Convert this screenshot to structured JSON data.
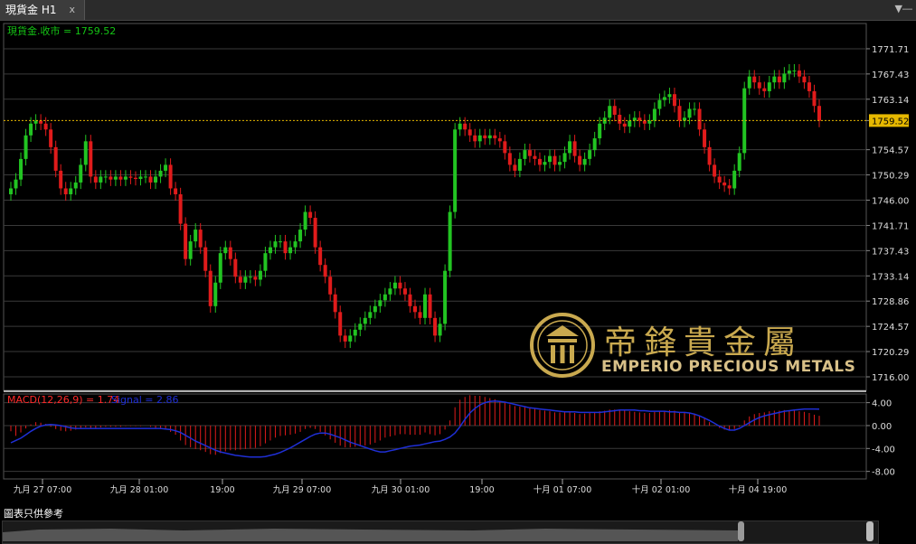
{
  "window": {
    "tab_title": "現貨金 H1",
    "close_glyph": "x",
    "menu_icon": "menu-down-icon"
  },
  "footer_label": "圖表只供參考",
  "logo": {
    "cn": "帝鋒貴金屬",
    "en": "EMPERIO PRECIOUS METALS"
  },
  "colors": {
    "up": "#22c422",
    "down": "#e01b1b",
    "grid": "#3a3a3a",
    "current_price": "#e6b800",
    "macd_line": "#1f2fd6",
    "macd_hist": "#e01b1b",
    "price_label": "#14c414",
    "macd_label": "#ff2a2a"
  },
  "chart_data": [
    {
      "type": "candlestick",
      "title": "現貨金.收市 = 1759.52",
      "current_price": 1759.52,
      "current_price_label": "1759.52",
      "ylim": [
        1713.7,
        1776.0
      ],
      "y_ticks": [
        "1771.71",
        "1767.43",
        "1763.14",
        "1759.52",
        "1754.57",
        "1750.29",
        "1746.00",
        "1741.71",
        "1737.43",
        "1733.14",
        "1728.86",
        "1724.57",
        "1720.29",
        "1716.00"
      ],
      "x_tick_labels": [
        "九月 27 07:00",
        "九月 28 01:00",
        "19:00",
        "九月 29 07:00",
        "九月 30 01:00",
        "19:00",
        "十月 01 07:00",
        "十月 02 01:00",
        "十月 04 19:00"
      ],
      "closes": [
        1748,
        1749.5,
        1753,
        1757,
        1759,
        1759.5,
        1759,
        1758,
        1755,
        1751,
        1748,
        1747,
        1748,
        1749,
        1752,
        1756,
        1750,
        1749,
        1750,
        1750,
        1749.5,
        1750,
        1749.5,
        1750,
        1749.8,
        1749.6,
        1750,
        1750,
        1749,
        1750,
        1751,
        1752,
        1748,
        1747,
        1742,
        1736,
        1739,
        1741,
        1738,
        1734,
        1728,
        1732,
        1737,
        1738,
        1736,
        1733,
        1732,
        1733,
        1733,
        1732.5,
        1734,
        1737,
        1738,
        1739,
        1739,
        1737,
        1738,
        1739,
        1741,
        1744,
        1743,
        1738,
        1735,
        1733,
        1730,
        1727,
        1723,
        1722,
        1723,
        1724,
        1725,
        1726,
        1727,
        1728,
        1729,
        1730,
        1731,
        1732,
        1731,
        1730,
        1728,
        1727,
        1726,
        1730,
        1726,
        1723,
        1725,
        1734,
        1744,
        1758,
        1759,
        1758,
        1757,
        1756,
        1757,
        1756.5,
        1757,
        1756.5,
        1756,
        1754,
        1752,
        1751,
        1753,
        1754.5,
        1753.5,
        1753,
        1752,
        1752.5,
        1753.5,
        1752,
        1752.5,
        1754,
        1756,
        1753.5,
        1752,
        1753,
        1754.5,
        1756.5,
        1759,
        1760,
        1762,
        1760.5,
        1759,
        1758.5,
        1759.5,
        1760,
        1759.5,
        1759,
        1759.5,
        1761.5,
        1763,
        1763.5,
        1764,
        1762,
        1759.5,
        1760,
        1761.5,
        1761.5,
        1758,
        1755,
        1752,
        1750,
        1749,
        1748.5,
        1748,
        1751,
        1754,
        1765,
        1767,
        1766,
        1765,
        1764.5,
        1766,
        1767,
        1766,
        1767.5,
        1768,
        1768,
        1767,
        1766,
        1764.5,
        1762,
        1759.5
      ]
    },
    {
      "type": "macd",
      "label": "MACD(12,26,9) = 1.74",
      "signal_label": "Signal = 2.86",
      "ylim": [
        -9.0,
        5.2
      ],
      "y_ticks": [
        "4.00",
        "0.00",
        "-4.00",
        "-8.00"
      ],
      "histogram": [
        -1,
        -1.8,
        -1.2,
        -0.5,
        0.2,
        0.6,
        0.5,
        0.3,
        -0.2,
        -0.6,
        -0.9,
        -1,
        -0.9,
        -0.7,
        -0.5,
        -0.3,
        -0.4,
        -0.4,
        -0.3,
        -0.2,
        -0.2,
        -0.2,
        -0.2,
        -0.1,
        -0.1,
        -0.1,
        -0.1,
        0,
        -0.2,
        -0.4,
        -0.6,
        -0.6,
        -1.1,
        -1.6,
        -2.6,
        -3.4,
        -3.8,
        -4.1,
        -4.3,
        -4.6,
        -5,
        -5.1,
        -4.8,
        -4.5,
        -4.3,
        -4.3,
        -4.2,
        -4.1,
        -4,
        -3.9,
        -3.6,
        -3.1,
        -2.6,
        -2.1,
        -1.8,
        -1.7,
        -1.6,
        -1.4,
        -1.1,
        -0.6,
        -0.4,
        -0.6,
        -1.1,
        -1.7,
        -2.4,
        -3,
        -3.5,
        -3.8,
        -3.8,
        -3.7,
        -3.6,
        -3.5,
        -3.3,
        -3,
        -2.6,
        -2.1,
        -1.9,
        -1.7,
        -1.5,
        -1.5,
        -1.6,
        -1.6,
        -1.6,
        -1.2,
        -1.5,
        -1.7,
        -1.5,
        -0.7,
        0.9,
        3.2,
        4.5,
        5,
        5.3,
        5.2,
        5.2,
        5,
        4.8,
        4.6,
        4.3,
        4,
        3.7,
        3.4,
        3.3,
        3.2,
        3,
        2.9,
        2.7,
        2.6,
        2.5,
        2.3,
        2.3,
        2.3,
        2.4,
        2.2,
        2,
        2.1,
        2.2,
        2.2,
        2.5,
        2.6,
        2.8,
        2.8,
        2.7,
        2.6,
        2.5,
        2.4,
        2.3,
        2.2,
        2.2,
        2.4,
        2.5,
        2.6,
        2.7,
        2.6,
        2.3,
        2.2,
        2.2,
        2.1,
        1.7,
        1.2,
        0.6,
        0.1,
        -0.4,
        -0.7,
        -0.8,
        -0.6,
        -0.2,
        0.9,
        1.6,
        2,
        2.2,
        2.3,
        2.5,
        2.6,
        2.6,
        2.7,
        2.6,
        2.6,
        2.5,
        2.4,
        2.2,
        1.9,
        1.7
      ],
      "signal": [
        -3,
        -2.6,
        -2.2,
        -1.6,
        -1,
        -0.5,
        -0.1,
        0.1,
        0.2,
        0.1,
        0,
        -0.2,
        -0.4,
        -0.5,
        -0.5,
        -0.5,
        -0.5,
        -0.5,
        -0.5,
        -0.5,
        -0.5,
        -0.5,
        -0.5,
        -0.5,
        -0.5,
        -0.5,
        -0.5,
        -0.5,
        -0.5,
        -0.5,
        -0.5,
        -0.6,
        -0.7,
        -0.9,
        -1.2,
        -1.7,
        -2.2,
        -2.7,
        -3.1,
        -3.5,
        -3.9,
        -4.3,
        -4.6,
        -4.8,
        -5,
        -5.2,
        -5.3,
        -5.4,
        -5.5,
        -5.5,
        -5.5,
        -5.4,
        -5.2,
        -5,
        -4.7,
        -4.3,
        -3.9,
        -3.4,
        -2.9,
        -2.4,
        -1.9,
        -1.5,
        -1.3,
        -1.3,
        -1.5,
        -1.8,
        -2.1,
        -2.5,
        -2.9,
        -3.2,
        -3.5,
        -3.8,
        -4.1,
        -4.4,
        -4.6,
        -4.6,
        -4.4,
        -4.2,
        -4,
        -3.8,
        -3.6,
        -3.5,
        -3.4,
        -3.2,
        -3,
        -2.8,
        -2.7,
        -2.4,
        -2,
        -1.3,
        -0.2,
        1.1,
        2.2,
        3,
        3.6,
        4,
        4.2,
        4.3,
        4.2,
        4.1,
        3.9,
        3.7,
        3.5,
        3.3,
        3.1,
        3,
        2.9,
        2.8,
        2.7,
        2.6,
        2.5,
        2.4,
        2.4,
        2.4,
        2.3,
        2.3,
        2.3,
        2.3,
        2.3,
        2.4,
        2.5,
        2.6,
        2.7,
        2.7,
        2.7,
        2.7,
        2.6,
        2.6,
        2.5,
        2.5,
        2.5,
        2.5,
        2.4,
        2.4,
        2.3,
        2.3,
        2.2,
        2,
        1.7,
        1.3,
        0.9,
        0.4,
        -0.1,
        -0.5,
        -0.8,
        -0.8,
        -0.5,
        0,
        0.5,
        1,
        1.4,
        1.7,
        1.9,
        2.1,
        2.3,
        2.5,
        2.6,
        2.7,
        2.8,
        2.9,
        2.9,
        2.9,
        2.86
      ]
    }
  ]
}
